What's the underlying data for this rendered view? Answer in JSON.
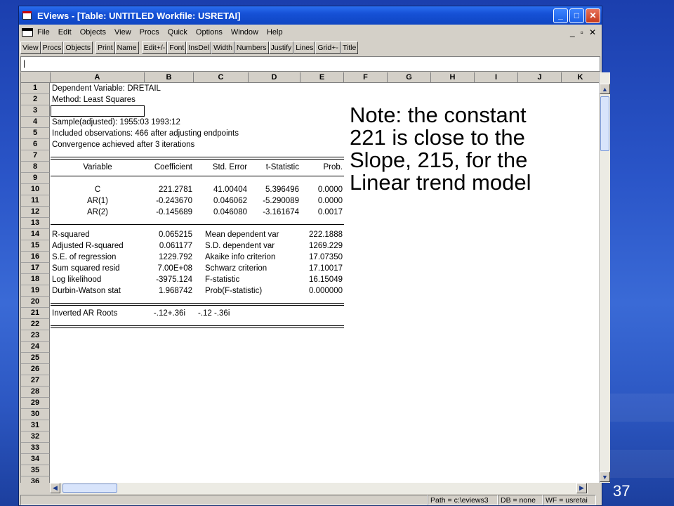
{
  "window": {
    "title": "EViews - [Table: UNTITLED    Workfile: USRETAI]",
    "controls": {
      "minimize": "_",
      "maximize": "□",
      "close": "✕"
    }
  },
  "menu": {
    "items": [
      "File",
      "Edit",
      "Objects",
      "View",
      "Procs",
      "Quick",
      "Options",
      "Window",
      "Help"
    ],
    "mdi_controls": [
      "_",
      "▫",
      "✕"
    ]
  },
  "toolbar": {
    "buttons": [
      "View",
      "Procs",
      "Objects",
      "Print",
      "Name",
      "Edit+/-",
      "Font",
      "InsDel",
      "Width",
      "Numbers",
      "Justify",
      "Lines",
      "Grid+-",
      "Title"
    ]
  },
  "edit_line": {
    "value": "|"
  },
  "grid": {
    "columns": [
      "A",
      "B",
      "C",
      "D",
      "E",
      "F",
      "G",
      "H",
      "I",
      "J",
      "K"
    ],
    "rows": [
      "1",
      "2",
      "3",
      "4",
      "5",
      "6",
      "7",
      "8",
      "9",
      "10",
      "11",
      "12",
      "13",
      "14",
      "15",
      "16",
      "17",
      "18",
      "19",
      "20",
      "21",
      "22",
      "23",
      "24",
      "25",
      "26",
      "27",
      "28",
      "29",
      "30",
      "31",
      "32",
      "33",
      "34",
      "35",
      "36"
    ],
    "header_lines": {
      "r1": "Dependent Variable: DRETAIL",
      "r2": "Method: Least Squares",
      "r4": "Sample(adjusted): 1955:03 1993:12",
      "r5": "Included observations: 466 after adjusting endpoints",
      "r6": "Convergence achieved after 3 iterations"
    },
    "coef_headers": [
      "Variable",
      "Coefficient",
      "Std. Error",
      "t-Statistic",
      "Prob."
    ],
    "coef_rows": [
      [
        "C",
        "221.2781",
        "41.00404",
        "5.396496",
        "0.0000"
      ],
      [
        "AR(1)",
        "-0.243670",
        "0.046062",
        "-5.290089",
        "0.0000"
      ],
      [
        "AR(2)",
        "-0.145689",
        "0.046080",
        "-3.161674",
        "0.0017"
      ]
    ],
    "stats_rows": [
      [
        "R-squared",
        "0.065215",
        "Mean dependent var",
        "222.1888"
      ],
      [
        "Adjusted R-squared",
        "0.061177",
        "S.D. dependent var",
        "1269.229"
      ],
      [
        "S.E. of regression",
        "1229.792",
        "Akaike info criterion",
        "17.07350"
      ],
      [
        "Sum squared resid",
        "7.00E+08",
        "Schwarz criterion",
        "17.10017"
      ],
      [
        "Log likelihood",
        "-3975.124",
        "F-statistic",
        "16.15049"
      ],
      [
        "Durbin-Watson stat",
        "1.968742",
        "Prob(F-statistic)",
        "0.000000"
      ]
    ],
    "inverted": {
      "label": "Inverted AR Roots",
      "root1": "-.12+.36i",
      "root2": "-.12 -.36i"
    }
  },
  "note": {
    "lines": [
      "Note: the constant",
      "221 is close to the",
      "Slope, 215, for the",
      "Linear trend model"
    ]
  },
  "statusbar": {
    "path": "Path = c:\\eviews3",
    "db": "DB = none",
    "wf": "WF = usretai"
  },
  "slide": {
    "page_number": "37"
  },
  "colors": {
    "titlebar": "#1651d6",
    "slide_bg": "#2a55c8",
    "note_text": "#000000"
  }
}
